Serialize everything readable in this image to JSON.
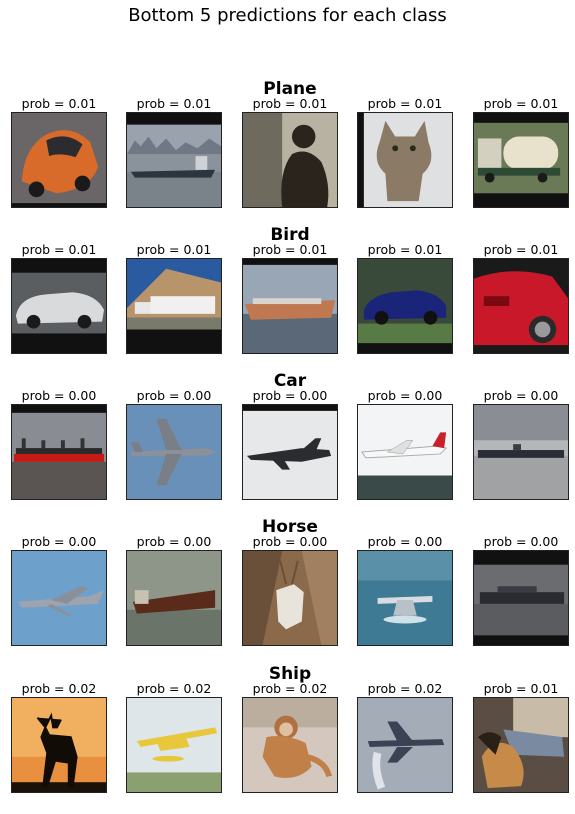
{
  "title": "Bottom 5 predictions for each class",
  "rows": [
    {
      "class_name": "Plane",
      "items": [
        {
          "prob": "prob = 0.01",
          "image": "orange small car"
        },
        {
          "prob": "prob = 0.01",
          "image": "ship on water with city skyline"
        },
        {
          "prob": "prob = 0.01",
          "image": "silhouette of monkey"
        },
        {
          "prob": "prob = 0.01",
          "image": "tabby cat"
        },
        {
          "prob": "prob = 0.01",
          "image": "tanker truck"
        }
      ]
    },
    {
      "class_name": "Bird",
      "items": [
        {
          "prob": "prob = 0.01",
          "image": "silver sports car"
        },
        {
          "prob": "prob = 0.01",
          "image": "semi truck on highway"
        },
        {
          "prob": "prob = 0.01",
          "image": "cargo ship"
        },
        {
          "prob": "prob = 0.01",
          "image": "blue sedan"
        },
        {
          "prob": "prob = 0.01",
          "image": "red car close-up"
        }
      ]
    },
    {
      "class_name": "Car",
      "items": [
        {
          "prob": "prob = 0.00",
          "image": "cargo ship at dusk"
        },
        {
          "prob": "prob = 0.00",
          "image": "jet plane in blue sky"
        },
        {
          "prob": "prob = 0.00",
          "image": "harrier jet"
        },
        {
          "prob": "prob = 0.00",
          "image": "propeller airliner"
        },
        {
          "prob": "prob = 0.00",
          "image": "ship on grey water"
        }
      ]
    },
    {
      "class_name": "Horse",
      "items": [
        {
          "prob": "prob = 0.00",
          "image": "fighter jet"
        },
        {
          "prob": "prob = 0.00",
          "image": "ship in fog"
        },
        {
          "prob": "prob = 0.00",
          "image": "white deer"
        },
        {
          "prob": "prob = 0.00",
          "image": "seaplane over water"
        },
        {
          "prob": "prob = 0.00",
          "image": "container ship"
        }
      ]
    },
    {
      "class_name": "Ship",
      "items": [
        {
          "prob": "prob = 0.02",
          "image": "deer silhouette at sunset"
        },
        {
          "prob": "prob = 0.02",
          "image": "yellow floatplane"
        },
        {
          "prob": "prob = 0.02",
          "image": "monkey"
        },
        {
          "prob": "prob = 0.02",
          "image": "military transport plane"
        },
        {
          "prob": "prob = 0.01",
          "image": "sleeping dog"
        }
      ]
    }
  ]
}
